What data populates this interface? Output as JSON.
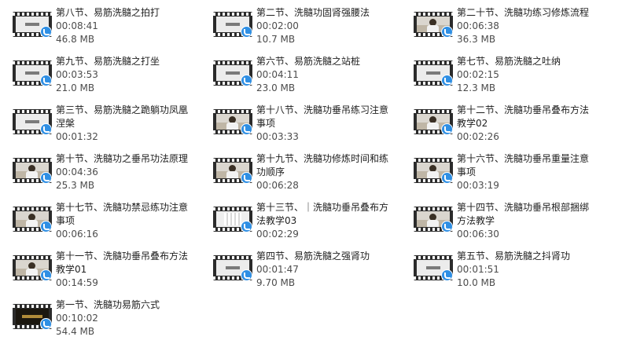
{
  "files": [
    {
      "name": "第八节、易筋洗髓之拍打",
      "duration": "00:08:41",
      "size": "46.8 MB",
      "thumb": "title-card"
    },
    {
      "name": "第二节、洗髓功固肾强腰法",
      "duration": "00:02:00",
      "size": "10.7 MB",
      "thumb": "title-card"
    },
    {
      "name": "第二十节、洗髓功练习修炼流程",
      "duration": "00:06:38",
      "size": "36.3 MB",
      "thumb": "person"
    },
    {
      "name": "第九节、易筋洗髓之打坐",
      "duration": "00:03:53",
      "size": "21.0 MB",
      "thumb": "title-card"
    },
    {
      "name": "第六节、易筋洗髓之站桩",
      "duration": "00:04:11",
      "size": "23.0 MB",
      "thumb": "title-card"
    },
    {
      "name": "第七节、易筋洗髓之吐纳",
      "duration": "00:02:15",
      "size": "12.3 MB",
      "thumb": "title-card"
    },
    {
      "name": "第三节、易筋洗髓之跪躺功凤凰涅槃",
      "duration": "00:01:32",
      "size": "",
      "thumb": "title-card"
    },
    {
      "name": "第十八节、洗髓功垂吊练习注意事项",
      "duration": "00:03:33",
      "size": "",
      "thumb": "person"
    },
    {
      "name": "第十二节、洗髓功垂吊叠布方法教学02",
      "duration": "00:02:26",
      "size": "",
      "thumb": "person"
    },
    {
      "name": "第十节、洗髓功之垂吊功法原理",
      "duration": "00:04:36",
      "size": "25.3 MB",
      "thumb": "person"
    },
    {
      "name": "第十九节、洗髓功修炼时间和练功顺序",
      "duration": "00:06:28",
      "size": "",
      "thumb": "person"
    },
    {
      "name": "第十六节、洗髓功垂吊重量注意事项",
      "duration": "00:03:19",
      "size": "",
      "thumb": "person"
    },
    {
      "name": "第十七节、洗髓功禁忌练功注意事项",
      "duration": "00:06:16",
      "size": "",
      "thumb": "person"
    },
    {
      "name": "第十三节、｜洗髓功垂吊叠布方法教学03",
      "duration": "00:02:29",
      "size": "",
      "thumb": "white-cloth"
    },
    {
      "name": "第十四节、洗髓功垂吊根部捆绑方法教学",
      "duration": "00:06:30",
      "size": "",
      "thumb": "person"
    },
    {
      "name": "第十一节、洗髓功垂吊叠布方法教学01",
      "duration": "00:14:59",
      "size": "",
      "thumb": "person"
    },
    {
      "name": "第四节、易筋洗髓之强肾功",
      "duration": "00:01:47",
      "size": "9.70 MB",
      "thumb": "title-card"
    },
    {
      "name": "第五节、易筋洗髓之抖肾功",
      "duration": "00:01:51",
      "size": "10.0 MB",
      "thumb": "title-card"
    },
    {
      "name": "第一节、洗髓功易筋六式",
      "duration": "00:10:02",
      "size": "54.4 MB",
      "thumb": "dark-gold"
    }
  ]
}
